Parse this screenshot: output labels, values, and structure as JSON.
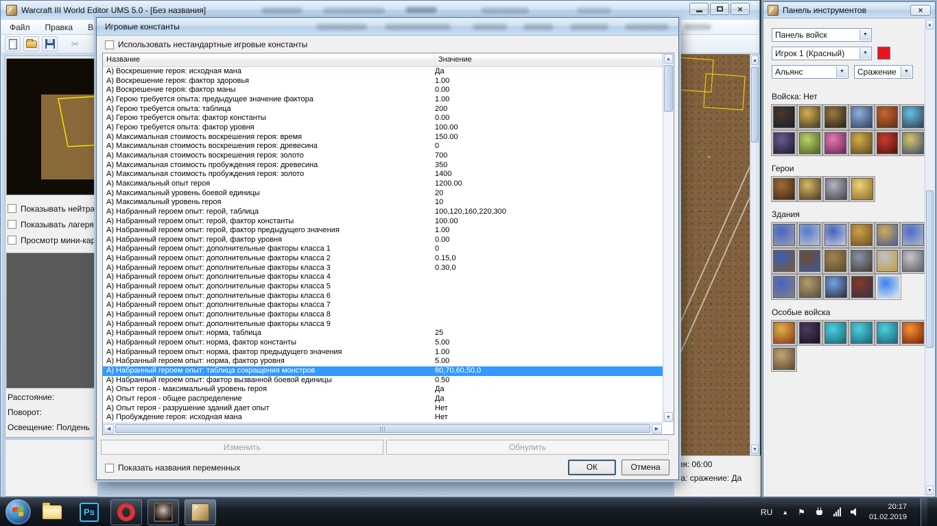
{
  "main_window": {
    "title": "Warcraft III World Editor UMS 5.0 - [Без названия]",
    "menu": [
      "Файл",
      "Правка",
      "Вид"
    ],
    "toolbar_icons": [
      "new-document",
      "open",
      "save",
      "cut"
    ],
    "sidebar": {
      "checkboxes": [
        "Показывать нейтра",
        "Показывать лагеря",
        "Просмотр мини-кар"
      ],
      "labels": [
        "Расстояние:",
        "Поворот:",
        "Освещение: Полдень"
      ]
    },
    "status": {
      "line1": "мя: 06:00",
      "line2": "та: сражение: Да"
    }
  },
  "dialog": {
    "title": "Игровые константы",
    "use_custom_label": "Использовать нестандартные игровые константы",
    "show_vars_label": "Показать названия переменных",
    "columns": [
      "Название",
      "Значение"
    ],
    "buttons": {
      "edit": "Изменить",
      "reset": "Обнулить",
      "ok": "ОК",
      "cancel": "Отмена"
    },
    "table": {
      "selected_index": 32,
      "rows": [
        {
          "n": "А) Воскрешение героя: исходная мана",
          "v": "Да"
        },
        {
          "n": "А) Воскрешение героя: фактор здоровья",
          "v": "1.00"
        },
        {
          "n": "А) Воскрешение героя: фактор маны",
          "v": "0.00"
        },
        {
          "n": "А) Герою требуется опыта: предыдущее значение фактора",
          "v": "1.00"
        },
        {
          "n": "А) Герою требуется опыта: таблица",
          "v": "200"
        },
        {
          "n": "А) Герою требуется опыта: фактор константы",
          "v": "0.00"
        },
        {
          "n": "А) Герою требуется опыта: фактор уровня",
          "v": "100.00"
        },
        {
          "n": "А) Максимальная стоимость воскрешения героя: время",
          "v": "150.00"
        },
        {
          "n": "А) Максимальная стоимость воскрешения героя: древесина",
          "v": "0"
        },
        {
          "n": "А) Максимальная стоимость воскрешения героя: золото",
          "v": "700"
        },
        {
          "n": "А) Максимальная стоимость пробуждения героя: древесина",
          "v": "350"
        },
        {
          "n": "А) Максимальная стоимость пробуждения героя: золото",
          "v": "1400"
        },
        {
          "n": "А) Максимальный опыт героя",
          "v": "1200.00"
        },
        {
          "n": "А) Максимальный уровень боевой единицы",
          "v": "20"
        },
        {
          "n": "А) Максимальный уровень героя",
          "v": "10"
        },
        {
          "n": "А) Набранный героем опыт: герой, таблица",
          "v": "100,120,160,220,300"
        },
        {
          "n": "А) Набранный героем опыт: герой, фактор константы",
          "v": "100.00"
        },
        {
          "n": "А) Набранный героем опыт: герой, фактор предыдущего значения",
          "v": "1.00"
        },
        {
          "n": "А) Набранный героем опыт: герой, фактор уровня",
          "v": "0.00"
        },
        {
          "n": "А) Набранный героем опыт: дополнительные факторы класса 1",
          "v": "0"
        },
        {
          "n": "А) Набранный героем опыт: дополнительные факторы класса 2",
          "v": "0.15,0"
        },
        {
          "n": "А) Набранный героем опыт: дополнительные факторы класса 3",
          "v": "0.30,0"
        },
        {
          "n": "А) Набранный героем опыт: дополнительные факторы класса 4",
          "v": ""
        },
        {
          "n": "А) Набранный героем опыт: дополнительные факторы класса 5",
          "v": ""
        },
        {
          "n": "А) Набранный героем опыт: дополнительные факторы класса 6",
          "v": ""
        },
        {
          "n": "А) Набранный героем опыт: дополнительные факторы класса 7",
          "v": ""
        },
        {
          "n": "А) Набранный героем опыт: дополнительные факторы класса 8",
          "v": ""
        },
        {
          "n": "А) Набранный героем опыт: дополнительные факторы класса 9",
          "v": ""
        },
        {
          "n": "А) Набранный героем опыт: норма, таблица",
          "v": "25"
        },
        {
          "n": "А) Набранный героем опыт: норма, фактор константы",
          "v": "5.00"
        },
        {
          "n": "А) Набранный героем опыт: норма, фактор предыдущего значения",
          "v": "1.00"
        },
        {
          "n": "А) Набранный героем опыт: норма, фактор уровня",
          "v": "5.00"
        },
        {
          "n": "А) Набранный героем опыт: таблица сокращения монстров",
          "v": "80,70,60,50,0"
        },
        {
          "n": "А) Набранный героем опыт: фактор вызванной боевой единицы",
          "v": "0.50"
        },
        {
          "n": "А) Опыт героя - максимальный уровень героя",
          "v": "Да"
        },
        {
          "n": "А) Опыт героя - общее распределение",
          "v": "Да"
        },
        {
          "n": "А) Опыт героя - разрушение зданий дает опыт",
          "v": "Нет"
        },
        {
          "n": "А) Пробуждение героя: исходная мана",
          "v": "Нет"
        }
      ]
    }
  },
  "tools_panel": {
    "title": "Панель инструментов",
    "dropdowns": {
      "panel": "Панель войск",
      "player": "Игрок 1 (Красный)",
      "alliance": "Альянс",
      "mode": "Сражение"
    },
    "player_color": "#e81420",
    "sections": [
      {
        "label": "Войска: Нет",
        "rows": [
          [
            [
              "#4a3828",
              "#141e2c"
            ],
            [
              "#d2b050",
              "#3a3020"
            ],
            [
              "#9a7a40",
              "#221c12"
            ],
            [
              "#8fb0dc",
              "#27395c"
            ],
            [
              "#c8642c",
              "#582814"
            ],
            [
              "#64c0e4",
              "#2c3646"
            ]
          ],
          [
            [
              "#6a5890",
              "#1c1430"
            ],
            [
              "#b8d468",
              "#46581c"
            ],
            [
              "#e478b4",
              "#641e50"
            ],
            [
              "#d4ac48",
              "#564418"
            ],
            [
              "#c83c30",
              "#4c0e0c"
            ],
            [
              "#d8c468",
              "#32466a"
            ]
          ]
        ]
      },
      {
        "label": "Герои",
        "rows": [
          [
            [
              "#a06a38",
              "#38220e"
            ],
            [
              "#d8b868",
              "#443218"
            ],
            [
              "#b0b4c0",
              "#3c3e48"
            ],
            [
              "#ecd478",
              "#86641e"
            ]
          ]
        ]
      },
      {
        "label": "Здания",
        "rows": [
          [
            [
              "#4a66c4",
              "#9aa2ac"
            ],
            [
              "#5578cc",
              "#c2cad4"
            ],
            [
              "#4462c0",
              "#ccd4de"
            ],
            [
              "#cfa143",
              "#6a4a22"
            ],
            [
              "#d2ac52",
              "#3e57a0"
            ],
            [
              "#4c6cc8",
              "#b4bcc6"
            ]
          ],
          [
            [
              "#3c5cb4",
              "#7c5c34"
            ],
            [
              "#6e4c2c",
              "#3a58a8"
            ],
            [
              "#a48454",
              "#564628"
            ],
            [
              "#8494aa",
              "#463626"
            ],
            [
              "#bcc4cc",
              "#c69a34"
            ],
            [
              "#c6c8cc",
              "#54545e"
            ]
          ],
          [
            [
              "#4662bc",
              "#83838b"
            ],
            [
              "#b49c6c",
              "#4f4838"
            ],
            [
              "#74a4e4",
              "#242436"
            ],
            [
              "#84392a",
              "#34304a"
            ],
            [
              "#3b82ec",
              "#e9edf3",
              true
            ]
          ]
        ]
      },
      {
        "label": "Особые войска",
        "rows": [
          [
            [
              "#dcb444",
              "#8c2c18"
            ],
            [
              "#4c3c60",
              "#140c1c"
            ],
            [
              "#4cd0e0",
              "#135e70"
            ],
            [
              "#4cd0e0",
              "#135e70"
            ],
            [
              "#4cd0e0",
              "#135e70"
            ],
            [
              "#f49434",
              "#7a1600"
            ]
          ],
          [
            [
              "#c4a474",
              "#54442a"
            ]
          ]
        ]
      }
    ]
  },
  "taskbar": {
    "photoshop_label": "Ps",
    "tray": {
      "language": "RU",
      "time": "20:17",
      "date": "01.02.2019"
    }
  }
}
